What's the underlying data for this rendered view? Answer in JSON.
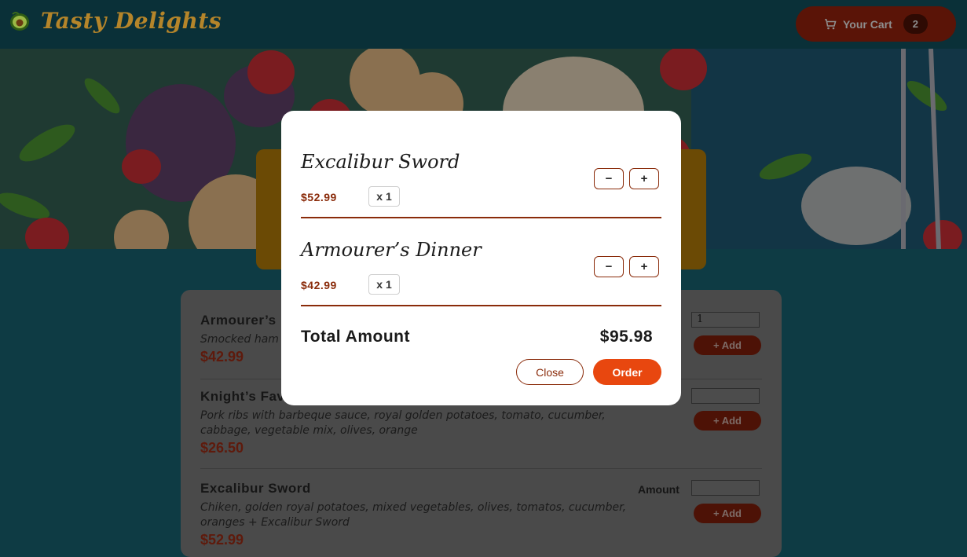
{
  "header": {
    "brand": "Tasty Delights",
    "logo_icon": "avocado-icon",
    "cart": {
      "label": "Your Cart",
      "count": "2",
      "icon": "cart-icon"
    }
  },
  "menu": {
    "meals": [
      {
        "name": "Armourer’s Dinner",
        "description": "Smocked ham",
        "price": "$42.99",
        "amount_value": "1",
        "add_label": "+ Add"
      },
      {
        "name": "Knight’s Favorite Meal",
        "description": "Pork ribs with barbeque sauce, royal golden potatoes, tomato, cucumber, cabbage, vegetable mix, olives, orange",
        "price": "$26.50",
        "amount_value": "",
        "add_label": "+ Add"
      },
      {
        "name": "Excalibur Sword",
        "description": "Chiken, golden royal potatoes, mixed vegetables, olives, tomatos, cucumber, oranges + Excalibur Sword",
        "price": "$52.99",
        "amount_label": "Amount",
        "amount_value": "",
        "add_label": "+ Add"
      }
    ]
  },
  "cart_modal": {
    "items": [
      {
        "name": "Excalibur Sword",
        "price": "$52.99",
        "qty": "x 1",
        "minus": "−",
        "plus": "+"
      },
      {
        "name": "Armourer’s Dinner",
        "price": "$42.99",
        "qty": "x 1",
        "minus": "−",
        "plus": "+"
      }
    ],
    "total_label": "Total Amount",
    "total_value": "$95.98",
    "close_label": "Close",
    "order_label": "Order"
  }
}
